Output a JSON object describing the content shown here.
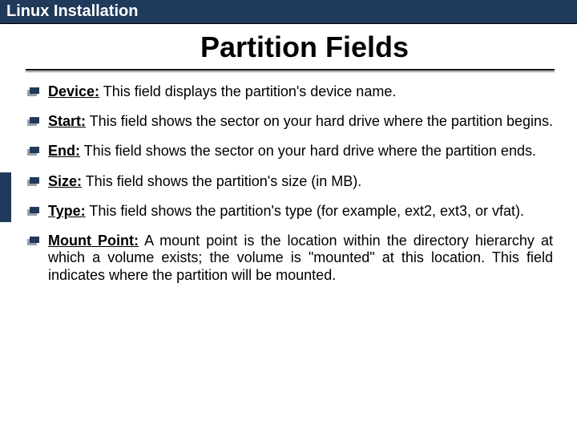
{
  "header": {
    "title": "Linux Installation"
  },
  "slide": {
    "title": "Partition Fields"
  },
  "items": [
    {
      "label": "Device:",
      "text": " This field displays the partition's device name."
    },
    {
      "label": "Start:",
      "text": " This field shows the sector on your hard drive where the partition begins."
    },
    {
      "label": "End:",
      "text": " This field shows the sector on your hard drive where the partition ends."
    },
    {
      "label": "Size:",
      "text": " This field shows the partition's size (in MB)."
    },
    {
      "label": "Type:",
      "text": " This field shows the partition's type (for example, ext2, ext3, or vfat)."
    },
    {
      "label": "Mount Point:",
      "text": " A mount point is the location within the directory hierarchy at which a volume exists; the volume is \"mounted\" at this location. This field indicates where the partition will be mounted."
    }
  ]
}
